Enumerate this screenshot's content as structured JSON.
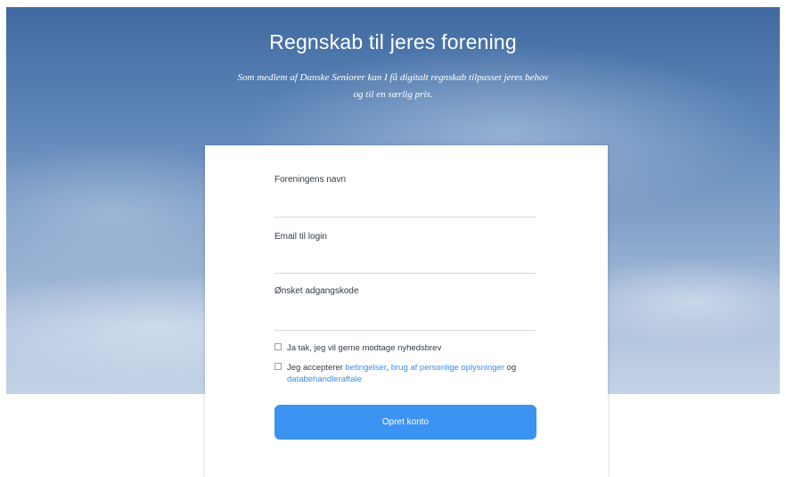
{
  "hero": {
    "title": "Regnskab til jeres forening",
    "subtitle_line1": "Som medlem af Danske Seniorer kan I få digitalt regnskab tilpasset jeres behov",
    "subtitle_line2": "og til en særlig pris."
  },
  "form": {
    "fields": [
      {
        "label": "Foreningens navn",
        "value": ""
      },
      {
        "label": "Email til login",
        "value": ""
      },
      {
        "label": "Ønsket adgangskode",
        "value": ""
      }
    ],
    "newsletter": {
      "checked": false,
      "label": "Ja tak, jeg vil gerne modtage nyhedsbrev"
    },
    "terms": {
      "checked": false,
      "prefix": "Jeg accepterer",
      "link_terms": "betingelser",
      "sep": ",",
      "link_privacy": "brug af personlige oplysninger",
      "and": "og",
      "link_dpa": "databehandleraftale"
    },
    "submit_label": "Opret konto"
  },
  "colors": {
    "accent": "#3d93f2",
    "link": "#3b8ee8",
    "text": "#333a40"
  }
}
